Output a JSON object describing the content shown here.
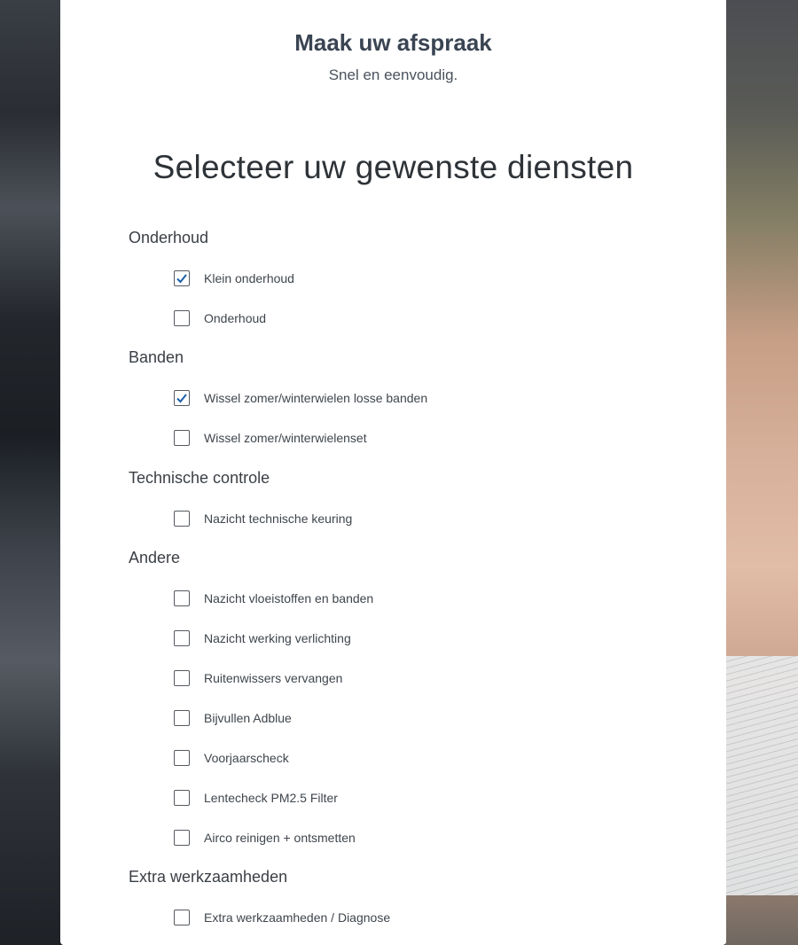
{
  "header": {
    "title": "Maak uw afspraak",
    "subtitle": "Snel en eenvoudig."
  },
  "section_title": "Selecteer uw gewenste diensten",
  "colors": {
    "accent": "#1a5fa8",
    "card": "#ffffff",
    "text": "#3a3f45"
  },
  "categories": [
    {
      "label": "Onderhoud",
      "options": [
        {
          "label": "Klein onderhoud",
          "checked": true
        },
        {
          "label": "Onderhoud",
          "checked": false
        }
      ]
    },
    {
      "label": "Banden",
      "options": [
        {
          "label": "Wissel zomer/winterwielen losse banden",
          "checked": true
        },
        {
          "label": "Wissel zomer/winterwielenset",
          "checked": false
        }
      ]
    },
    {
      "label": "Technische controle",
      "options": [
        {
          "label": "Nazicht technische keuring",
          "checked": false
        }
      ]
    },
    {
      "label": "Andere",
      "options": [
        {
          "label": "Nazicht vloeistoffen en banden",
          "checked": false
        },
        {
          "label": "Nazicht werking verlichting",
          "checked": false
        },
        {
          "label": "Ruitenwissers vervangen",
          "checked": false
        },
        {
          "label": "Bijvullen Adblue",
          "checked": false
        },
        {
          "label": "Voorjaarscheck",
          "checked": false
        },
        {
          "label": "Lentecheck PM2.5 Filter",
          "checked": false
        },
        {
          "label": "Airco reinigen + ontsmetten",
          "checked": false
        }
      ]
    },
    {
      "label": "Extra werkzaamheden",
      "options": [
        {
          "label": "Extra werkzaamheden / Diagnose",
          "checked": false
        }
      ]
    }
  ]
}
